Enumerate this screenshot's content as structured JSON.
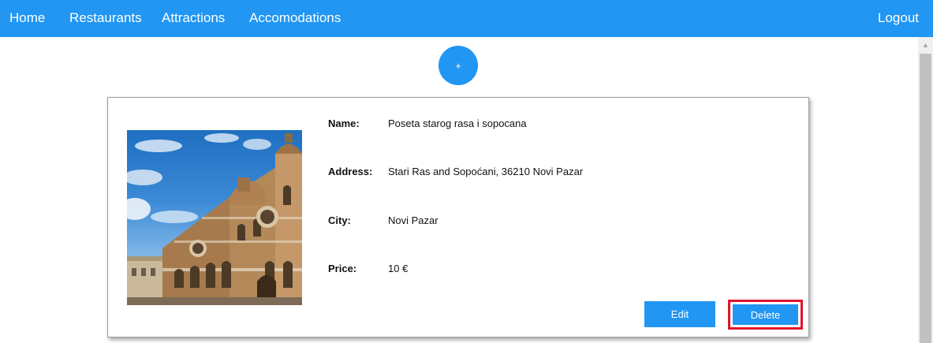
{
  "nav": {
    "home": "Home",
    "restaurants": "Restaurants",
    "attractions": "Attractions",
    "accomodations": "Accomodations",
    "logout": "Logout"
  },
  "add_button_label": "+",
  "attraction": {
    "labels": {
      "name": "Name:",
      "address": "Address:",
      "city": "City:",
      "price": "Price:"
    },
    "name": "Poseta starog rasa i sopocana",
    "address": "Stari Ras and Sopoćani, 36210 Novi Pazar",
    "city": "Novi Pazar",
    "price": "10 €",
    "image_icon": "synagogue-building-photo"
  },
  "actions": {
    "edit": "Edit",
    "delete": "Delete"
  },
  "colors": {
    "primary": "#2196f3",
    "highlight": "#e0142b"
  }
}
